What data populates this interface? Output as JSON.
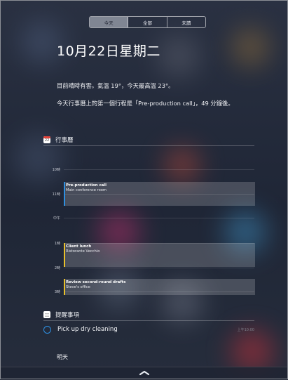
{
  "tabs": [
    {
      "label": "今天",
      "active": true
    },
    {
      "label": "全部",
      "active": false
    },
    {
      "label": "未讀",
      "active": false
    }
  ],
  "date_title": "10月22日星期二",
  "summary": {
    "line1": "目前晴時有雲。氣溫 19°，今天最高溫 23°。",
    "line2": "今天行事曆上的第一個行程是「Pre-production call」，49 分鐘後。"
  },
  "calendar": {
    "header": "行事曆",
    "icon": "calendar-icon",
    "hours": [
      "10時",
      "11時",
      "中午",
      "1時",
      "2時",
      "3時"
    ],
    "events": [
      {
        "title": "Pre-production call",
        "location": "Main conference room",
        "color": "#2e8fe0"
      },
      {
        "title": "Client lunch",
        "location": "Ristorante Vecchio",
        "color": "#e8c02a"
      },
      {
        "title": "Review second-round drafts",
        "location": "Steve's office",
        "color": "#e8c02a"
      }
    ]
  },
  "reminders": {
    "header": "提醒事項",
    "icon": "reminders-icon",
    "items": [
      {
        "text": "Pick up dry cleaning",
        "time": "上午10:00"
      }
    ]
  },
  "tomorrow_label": "明天",
  "bottom_handle_icon": "chevron-up-icon",
  "colors": {
    "accent_blue": "#2e8fe0",
    "accent_yellow": "#e8c02a"
  }
}
